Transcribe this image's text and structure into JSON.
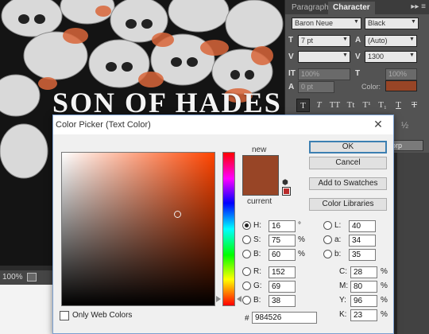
{
  "artwork": {
    "title": "SON OF HADES",
    "zoom": "100%"
  },
  "character_panel": {
    "tabs": [
      "Paragraph",
      "Character"
    ],
    "active_tab": "Character",
    "menu_glyph": "▸▸ ≡",
    "font_family": "Baron Neue",
    "font_style": "Black",
    "font_size": "7 pt",
    "leading": "(Auto)",
    "kerning": "",
    "tracking": "1300",
    "vertical_scale": "100%",
    "horizontal_scale": "100%",
    "baseline_shift": "0 pt",
    "color_label": "Color:",
    "color_value": "#984526",
    "style_buttons": [
      "T",
      "T",
      "TT",
      "Tt",
      "T¹",
      "T₁",
      "T",
      "T"
    ],
    "half_glyph": "½",
    "dropdown_value": "orp"
  },
  "dialog": {
    "title": "Color Picker (Text Color)",
    "close_glyph": "✕",
    "new_label": "new",
    "current_label": "current",
    "new_color": "#984526",
    "current_color": "#984526",
    "hue_marker_fraction": 0.956,
    "sv_marker": {
      "saturation": 0.75,
      "brightness": 0.6
    },
    "buttons": {
      "ok": "OK",
      "cancel": "Cancel",
      "add_to_swatches": "Add to Swatches",
      "color_libraries": "Color Libraries"
    },
    "hsb": [
      {
        "label": "H:",
        "value": "16",
        "unit": "°",
        "selected": true
      },
      {
        "label": "S:",
        "value": "75",
        "unit": "%",
        "selected": false
      },
      {
        "label": "B:",
        "value": "60",
        "unit": "%",
        "selected": false
      }
    ],
    "rgb": [
      {
        "label": "R:",
        "value": "152",
        "selected": false
      },
      {
        "label": "G:",
        "value": "69",
        "selected": false
      },
      {
        "label": "B:",
        "value": "38",
        "selected": false
      }
    ],
    "lab": [
      {
        "label": "L:",
        "value": "40",
        "selected": false
      },
      {
        "label": "a:",
        "value": "34",
        "selected": false
      },
      {
        "label": "b:",
        "value": "35",
        "selected": false
      }
    ],
    "cmyk": [
      {
        "label": "C:",
        "value": "28",
        "unit": "%"
      },
      {
        "label": "M:",
        "value": "80",
        "unit": "%"
      },
      {
        "label": "Y:",
        "value": "96",
        "unit": "%"
      },
      {
        "label": "K:",
        "value": "23",
        "unit": "%"
      }
    ],
    "hex_hash": "#",
    "hex": "984526",
    "only_web_colors": "Only Web Colors"
  }
}
